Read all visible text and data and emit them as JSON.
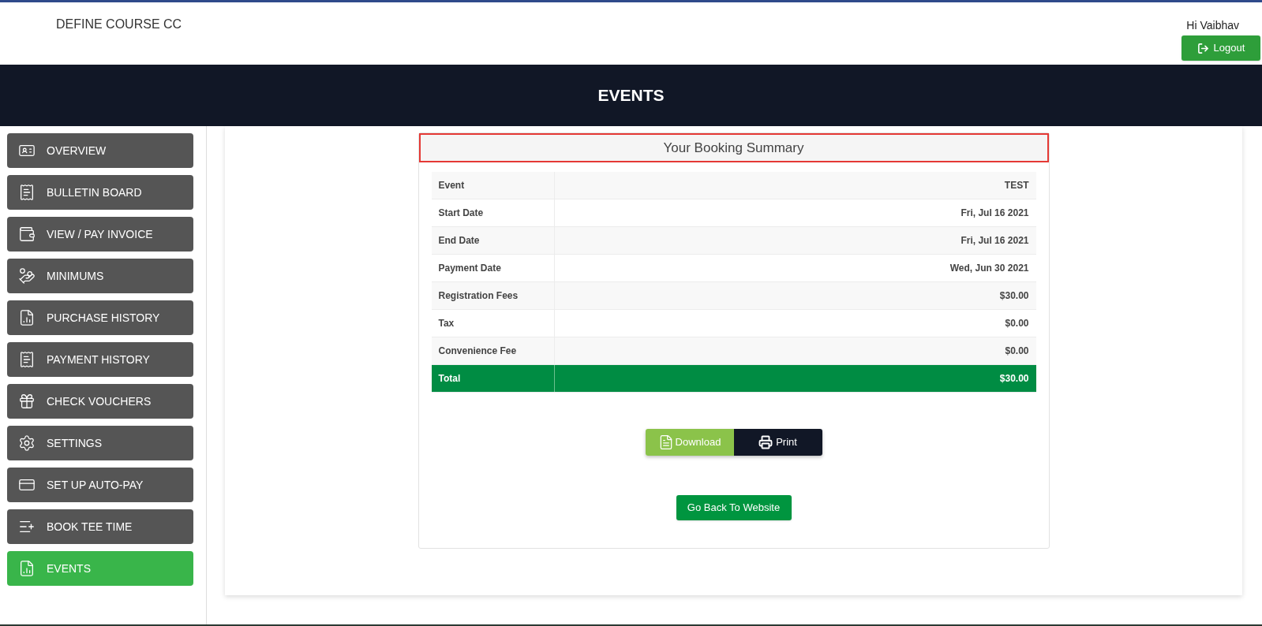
{
  "header": {
    "brand": "DEFINE COURSE CC",
    "greeting": "Hi Vaibhav",
    "logout": "Logout"
  },
  "page_title": "EVENTS",
  "sidebar": {
    "items": [
      {
        "label": "OVERVIEW",
        "selected": false
      },
      {
        "label": "BULLETIN BOARD",
        "selected": false
      },
      {
        "label": "VIEW / PAY INVOICE",
        "selected": false
      },
      {
        "label": "MINIMUMS",
        "selected": false
      },
      {
        "label": "PURCHASE HISTORY",
        "selected": false
      },
      {
        "label": "PAYMENT HISTORY",
        "selected": false
      },
      {
        "label": "CHECK VOUCHERS",
        "selected": false
      },
      {
        "label": "SETTINGS",
        "selected": false
      },
      {
        "label": "SET UP AUTO-PAY",
        "selected": false
      },
      {
        "label": "BOOK TEE TIME",
        "selected": false
      },
      {
        "label": "EVENTS",
        "selected": true
      }
    ]
  },
  "summary": {
    "title": "Your Booking Summary",
    "rows": [
      {
        "label": "Event",
        "value": "TEST",
        "kind": "plain"
      },
      {
        "label": "Start Date",
        "value": "Fri, Jul 16 2021",
        "kind": "plain"
      },
      {
        "label": "End Date",
        "value": "Fri, Jul 16 2021",
        "kind": "plain"
      },
      {
        "label": "Payment Date",
        "value": "Wed, Jun 30 2021",
        "kind": "plain"
      },
      {
        "label": "Registration Fees",
        "value": "$30.00",
        "kind": "plain"
      },
      {
        "label": "Tax",
        "value": "$0.00",
        "kind": "plain"
      },
      {
        "label": "Convenience Fee",
        "value": "$0.00",
        "kind": "plain"
      },
      {
        "label": "Total",
        "value": "$30.00",
        "kind": "total"
      }
    ],
    "download": "Download",
    "print": "Print",
    "back": "Go Back To Website"
  }
}
